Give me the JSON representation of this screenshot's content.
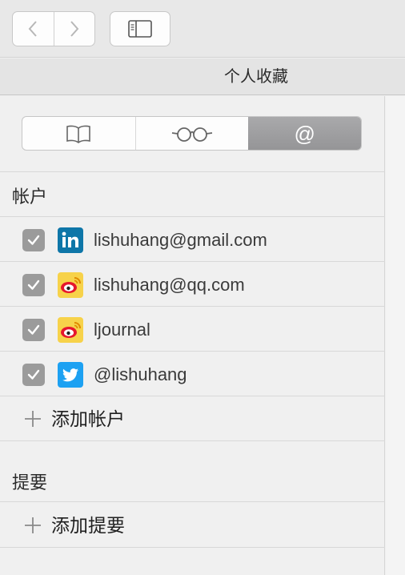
{
  "window": {
    "title": "个人收藏"
  },
  "toolbar": {
    "back_icon": "chevron-left-icon",
    "forward_icon": "chevron-right-icon",
    "sidebar_icon": "sidebar-toggle-icon"
  },
  "segmented": {
    "tabs": [
      {
        "icon": "book-icon",
        "label": "",
        "active": false
      },
      {
        "icon": "glasses-icon",
        "label": "",
        "active": false
      },
      {
        "icon": "at-icon",
        "label": "@",
        "active": true
      }
    ]
  },
  "accounts": {
    "header": "帐户",
    "items": [
      {
        "label": "lishuhang@gmail.com",
        "checked": true,
        "service_icon": "linkedin-icon"
      },
      {
        "label": "lishuhang@qq.com",
        "checked": true,
        "service_icon": "weibo-icon"
      },
      {
        "label": "ljournal",
        "checked": true,
        "service_icon": "weibo-icon"
      },
      {
        "label": "@lishuhang",
        "checked": true,
        "service_icon": "twitter-icon"
      }
    ],
    "add_label": "添加帐户"
  },
  "feeds": {
    "header": "提要",
    "add_label": "添加提要"
  },
  "colors": {
    "linkedin": "#0e76a8",
    "twitter": "#1da1f2",
    "weibo_bg": "#f7d24a",
    "weibo_red": "#e6162d",
    "checkbox": "#9b9b9b",
    "active_segment": "#a0a0a2"
  }
}
